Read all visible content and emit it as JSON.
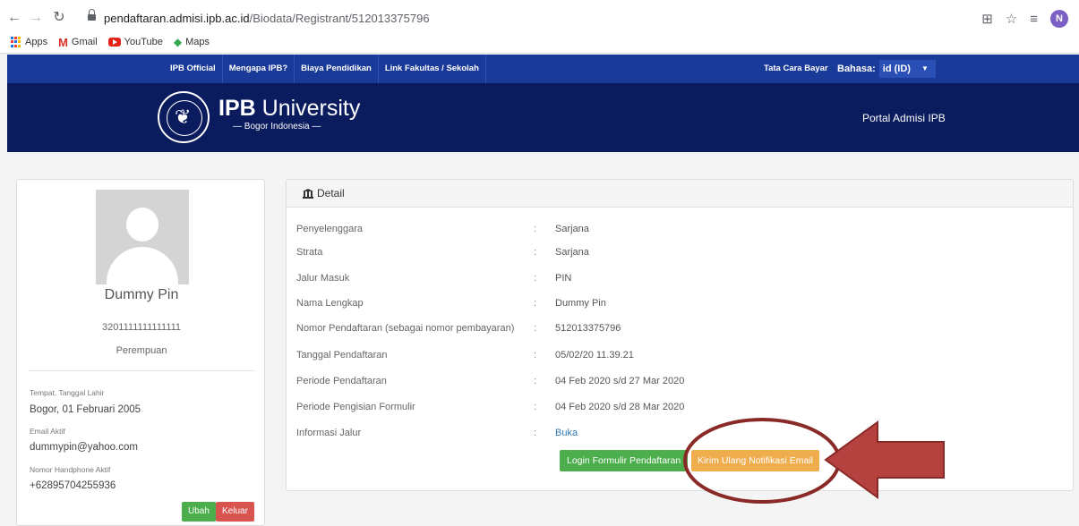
{
  "browser": {
    "url_host": "pendaftaran.admisi.ipb.ac.id",
    "url_path": "/Biodata/Registrant/512013375796",
    "profile_initial": "N",
    "bookmarks": [
      "Apps",
      "Gmail",
      "YouTube",
      "Maps"
    ]
  },
  "topnav": {
    "links": [
      "IPB Official",
      "Mengapa IPB?",
      "Biaya Pendidikan",
      "Link Fakultas / Sekolah"
    ],
    "tata_cara": "Tata Cara Bayar",
    "bahasa_label": "Bahasa:",
    "bahasa_value": "id (ID)"
  },
  "banner": {
    "brand_bold": "IPB",
    "brand_rest": " University",
    "subtitle": "— Bogor Indonesia —",
    "portal": "Portal Admisi IPB"
  },
  "profile": {
    "name": "Dummy Pin",
    "nik": "3201111111111111",
    "gender": "Perempuan",
    "ttl_label": "Tempat, Tanggal Lahir",
    "ttl_value": "Bogor, 01 Februari 2005",
    "email_label": "Email Aktif",
    "email_value": "dummypin@yahoo.com",
    "phone_label": "Nomor Handphone Aktif",
    "phone_value": "+62895704255936",
    "ubah": "Ubah",
    "keluar": "Keluar"
  },
  "detail": {
    "title": "Detail",
    "rows": [
      {
        "label": "Penyelenggara",
        "value": "Sarjana"
      },
      {
        "label": "Strata",
        "value": "Sarjana"
      },
      {
        "label": "Jalur Masuk",
        "value": "PIN"
      },
      {
        "label": "Nama Lengkap",
        "value": "Dummy Pin"
      },
      {
        "label": "Nomor Pendaftaran (sebagai nomor pembayaran)",
        "value": "512013375796"
      },
      {
        "label": "Tanggal Pendaftaran",
        "value": "05/02/20 11.39.21"
      },
      {
        "label": "Periode Pendaftaran",
        "value": "04 Feb 2020 s/d 27 Mar 2020"
      },
      {
        "label": "Periode Pengisian Formulir",
        "value": "04 Feb 2020 s/d 28 Mar 2020"
      },
      {
        "label": "Informasi Jalur",
        "value": "Buka"
      }
    ],
    "colon": ":",
    "login_button": "Login Formulir Pendaftaran",
    "kirim_button": "Kirim Ulang Notifikasi Email"
  },
  "colors": {
    "nav_blue": "#1a3a99",
    "banner_navy": "#0a1b5e",
    "success": "#4cae4c",
    "warning": "#f0ad4e",
    "danger": "#d9534f",
    "annotation": "#b5423f"
  }
}
